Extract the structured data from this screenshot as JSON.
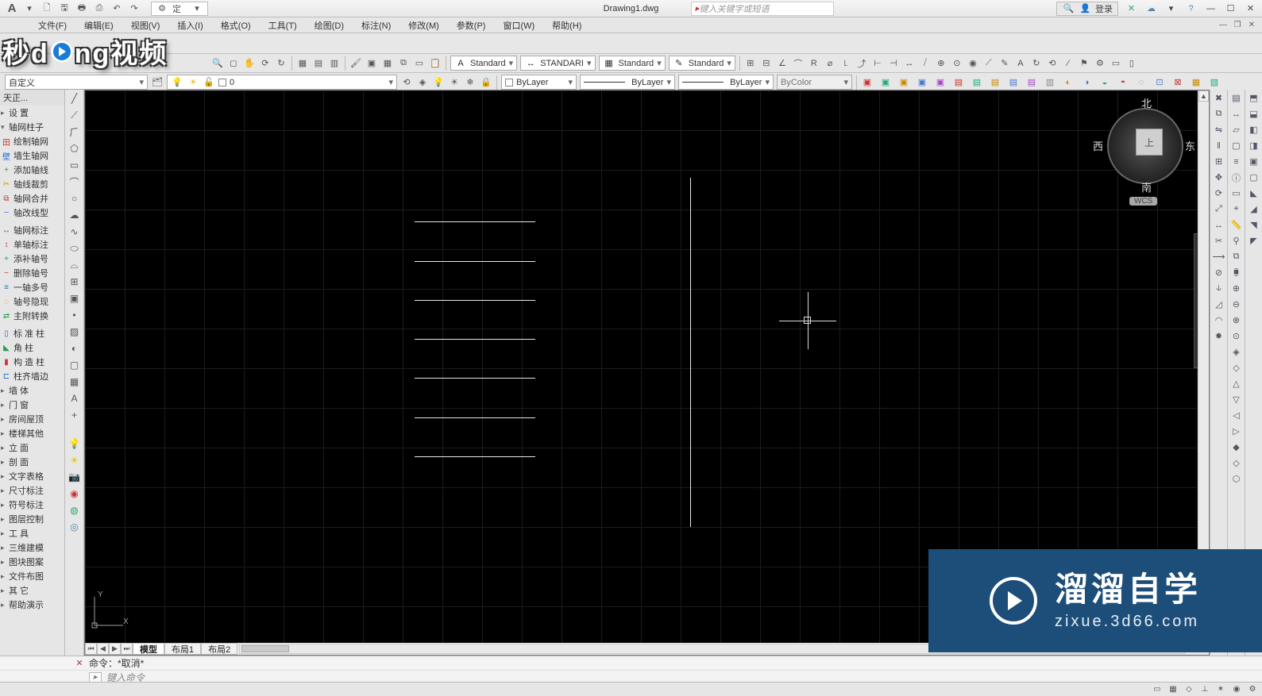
{
  "app": {
    "title": "Drawing1.dwg",
    "workspace": "自定义",
    "search_placeholder": "键入关键字或短语",
    "login": "登录"
  },
  "watermark": "秒d  ng视频",
  "menu": {
    "items": [
      "文件(F)",
      "编辑(E)",
      "视图(V)",
      "插入(I)",
      "格式(O)",
      "工具(T)",
      "绘图(D)",
      "标注(N)",
      "修改(M)",
      "参数(P)",
      "窗口(W)",
      "帮助(H)"
    ]
  },
  "styles_row": {
    "textstyle": "Standard",
    "dimstyle": "STANDARI",
    "tablestyle": "Standard",
    "mlstyle": "Standard"
  },
  "layer_row": {
    "filter": "自定义",
    "current_layer": "0",
    "color": "ByLayer",
    "linetype": "ByLayer",
    "lineweight": "ByLayer",
    "plotstyle": "ByColor"
  },
  "tianzheng": {
    "title": "天正...",
    "settings": "设    置",
    "group1": "轴网柱子",
    "items1": [
      "绘制轴网",
      "墙生轴网",
      "添加轴线",
      "轴线裁剪",
      "轴网合并",
      "轴改线型"
    ],
    "items2": [
      "轴网标注",
      "单轴标注",
      "添补轴号",
      "删除轴号",
      "一轴多号",
      "轴号隐现",
      "主附转换"
    ],
    "items3": [
      "标 准 柱",
      "角    柱",
      "构 造 柱",
      "柱齐墙边"
    ],
    "groups": [
      "墙    体",
      "门    窗",
      "房间屋顶",
      "楼梯其他",
      "立    面",
      "剖    面",
      "文字表格",
      "尺寸标注",
      "符号标注",
      "图层控制",
      "工    具",
      "三维建模",
      "图块图案",
      "文件布图",
      "其    它",
      "帮助演示"
    ]
  },
  "tabs": {
    "model": "模型",
    "layout1": "布局1",
    "layout2": "布局2"
  },
  "command": {
    "history": "命令：*取消*",
    "prompt_icon": "▸",
    "prompt_placeholder": "键入命令"
  },
  "navcube": {
    "n": "北",
    "s": "南",
    "e": "东",
    "w": "西",
    "top": "上",
    "wcs": "WCS"
  },
  "ucs": {
    "x": "X",
    "y": "Y"
  },
  "logo": {
    "title": "溜溜自学",
    "sub": "zixue.3d66.com"
  }
}
